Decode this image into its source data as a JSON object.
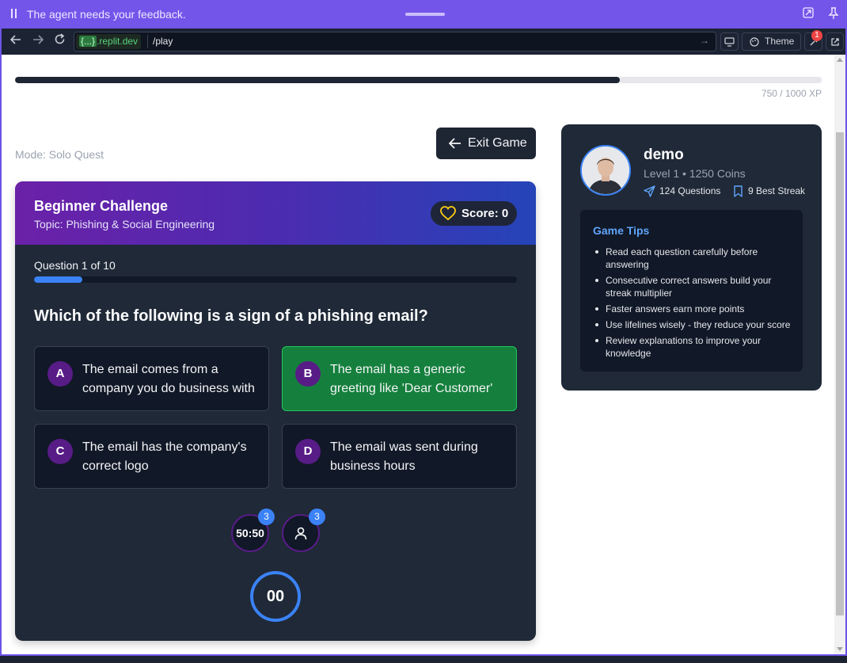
{
  "agent_bar": {
    "message": "The agent needs your feedback."
  },
  "browser": {
    "domain_badge": "{...}",
    "domain": ".replit.dev",
    "path": "/play",
    "theme_label": "Theme",
    "notification_count": "1"
  },
  "xp": {
    "text": "750 / 1000 XP",
    "progress": 0.75
  },
  "mode": "Mode: Solo Quest",
  "exit_label": "Exit Game",
  "quiz": {
    "title": "Beginner Challenge",
    "topic": "Topic: Phishing & Social Engineering",
    "score": "Score: 0",
    "question_count": "Question 1 of 10",
    "question_progress": 0.1,
    "question": "Which of the following is a sign of a phishing email?",
    "options": [
      {
        "letter": "A",
        "text": "The email comes from a company you do business with"
      },
      {
        "letter": "B",
        "text": "The email has a generic greeting like 'Dear Customer'"
      },
      {
        "letter": "C",
        "text": "The email has the company's correct logo"
      },
      {
        "letter": "D",
        "text": "The email was sent during business hours"
      }
    ],
    "selected_option": "B",
    "lifelines": [
      {
        "label": "50:50",
        "count": "3"
      },
      {
        "icon": "user-icon",
        "count": "3"
      }
    ],
    "timer": "00"
  },
  "profile": {
    "name": "demo",
    "level": "Level 1 • 1250 Coins",
    "questions": "124 Questions",
    "streak": "9 Best Streak",
    "tips_title": "Game Tips",
    "tips": [
      "Read each question carefully before answering",
      "Consecutive correct answers build your streak multiplier",
      "Faster answers earn more points",
      "Use lifelines wisely - they reduce your score",
      "Review explanations to improve your knowledge"
    ]
  },
  "colors": {
    "accent": "#3b82f6",
    "selected": "#15803d",
    "card": "#1f2937",
    "agent_bar": "#7355ea"
  }
}
